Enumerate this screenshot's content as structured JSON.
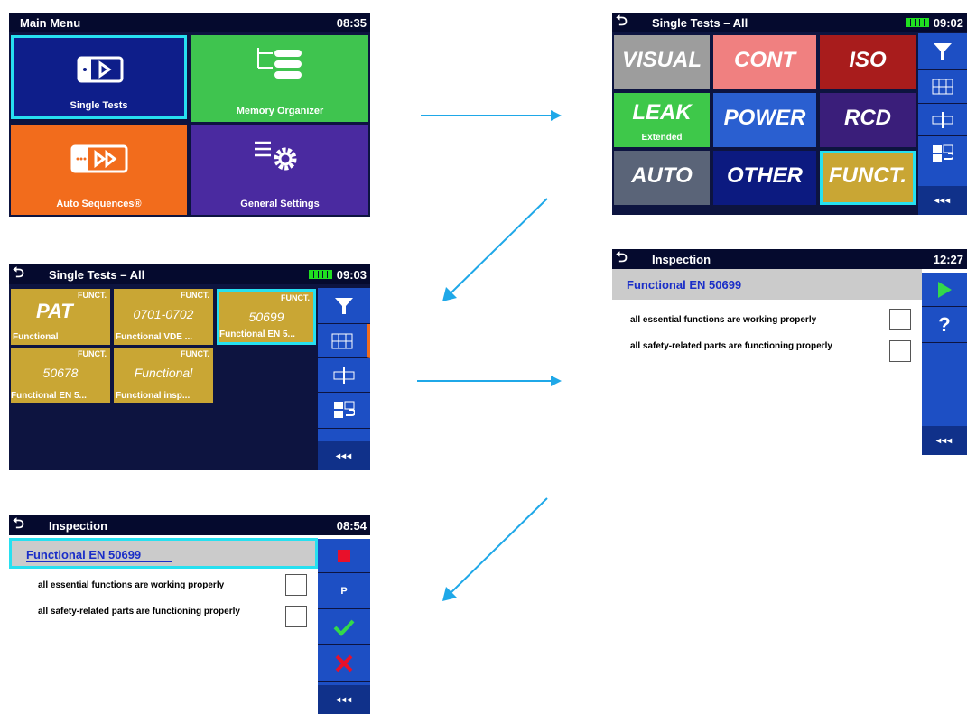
{
  "main_menu": {
    "title": "Main Menu",
    "time": "08:35",
    "tiles": [
      {
        "label": "Single Tests",
        "color": "#0e1e8a"
      },
      {
        "label": "Memory Organizer",
        "color": "#3fc44f"
      },
      {
        "label": "Auto Sequences®",
        "color": "#f26c1c"
      },
      {
        "label": "General Settings",
        "color": "#4a2aa0"
      }
    ]
  },
  "single_tests_groups": {
    "back_icon": "back-arrow-icon",
    "title": "Single Tests – All",
    "time": "09:02",
    "groups": [
      {
        "label": "VISUAL",
        "color": "#9d9d9d"
      },
      {
        "label": "CONT",
        "color": "#f08080"
      },
      {
        "label": "ISO",
        "color": "#a81c1c"
      },
      {
        "label": "LEAK",
        "sub": "Extended",
        "color": "#3ec84a"
      },
      {
        "label": "POWER",
        "color": "#2a5fd0"
      },
      {
        "label": "RCD",
        "color": "#3a1e7a"
      },
      {
        "label": "AUTO",
        "color": "#5a6478"
      },
      {
        "label": "OTHER",
        "color": "#0c1a80"
      },
      {
        "label": "FUNCT.",
        "color": "#c9a634"
      }
    ],
    "more": "◂◂◂"
  },
  "single_tests_funct": {
    "title": "Single Tests – All",
    "time": "09:03",
    "tests": [
      {
        "category": "FUNCT.",
        "name": "PAT",
        "desc": "Functional"
      },
      {
        "category": "FUNCT.",
        "name": "0701-0702",
        "desc": "Functional VDE ..."
      },
      {
        "category": "FUNCT.",
        "name": "50699",
        "desc": "Functional EN 5..."
      },
      {
        "category": "FUNCT.",
        "name": "50678",
        "desc": "Functional EN 5..."
      },
      {
        "category": "FUNCT.",
        "name": "Functional",
        "desc": "Functional insp..."
      }
    ],
    "more": "◂◂◂"
  },
  "inspection_start": {
    "title": "Inspection",
    "time": "12:27",
    "test_name": "Functional EN 50699",
    "items": [
      "all essential functions are working properly",
      "all safety-related parts are functioning properly"
    ],
    "help": "?",
    "more": "◂◂◂"
  },
  "inspection_running": {
    "title": "Inspection",
    "time": "08:54",
    "test_name": "Functional EN 50699",
    "items": [
      "all essential functions are working properly",
      "all safety-related parts are functioning properly"
    ],
    "pass_label": "P",
    "more": "◂◂◂"
  },
  "colors": {
    "arrow": "#1fa8e8",
    "highlight": "#27e0f0",
    "side_panel": "#1d4fc4"
  }
}
